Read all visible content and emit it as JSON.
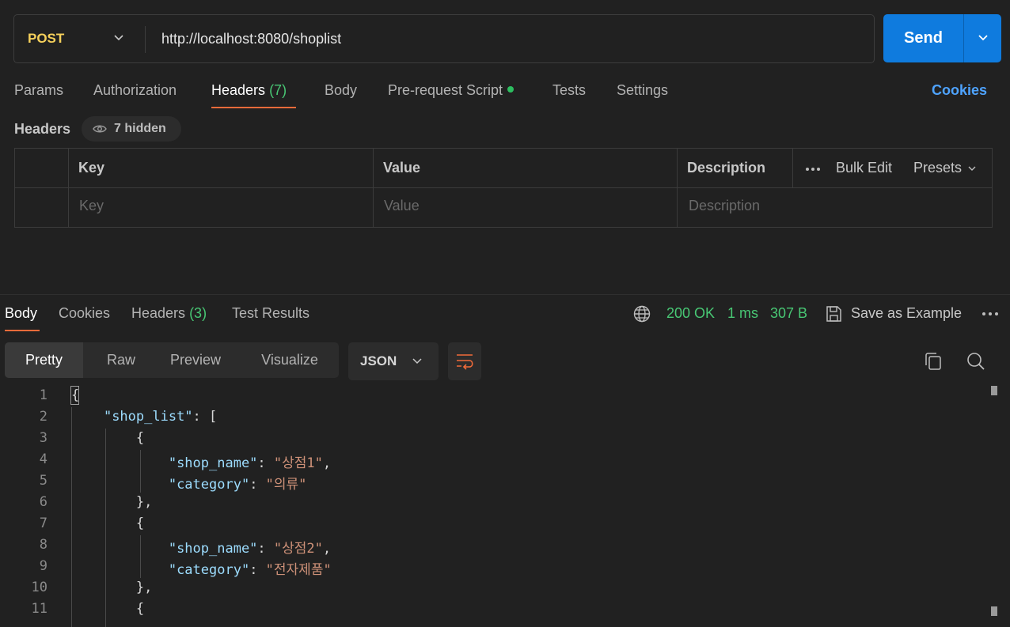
{
  "request": {
    "method": "POST",
    "url": "http://localhost:8080/shoplist",
    "send_label": "Send"
  },
  "request_tabs": {
    "params": "Params",
    "authorization": "Authorization",
    "headers": "Headers",
    "headers_count": "(7)",
    "body": "Body",
    "prerequest": "Pre-request Script",
    "tests": "Tests",
    "settings": "Settings",
    "cookies": "Cookies"
  },
  "headers_section": {
    "label": "Headers",
    "hidden": "7 hidden",
    "columns": {
      "key": "Key",
      "value": "Value",
      "description": "Description"
    },
    "placeholders": {
      "key": "Key",
      "value": "Value",
      "description": "Description"
    },
    "bulk_edit": "Bulk Edit",
    "presets": "Presets"
  },
  "response_tabs": {
    "body": "Body",
    "cookies": "Cookies",
    "headers": "Headers",
    "headers_count": "(3)",
    "test_results": "Test Results"
  },
  "response_status": {
    "status": "200 OK",
    "time": "1 ms",
    "size": "307 B",
    "save_as_example": "Save as Example"
  },
  "view_modes": {
    "pretty": "Pretty",
    "raw": "Raw",
    "preview": "Preview",
    "visualize": "Visualize",
    "format": "JSON"
  },
  "code_lines": {
    "n1": "1",
    "n2": "2",
    "n3": "3",
    "n4": "4",
    "n5": "5",
    "n6": "6",
    "n7": "7",
    "n8": "8",
    "n9": "9",
    "n10": "10",
    "n11": "11",
    "l2_key": "\"shop_list\"",
    "l4_key": "\"shop_name\"",
    "l4_val": "\"상점1\"",
    "l5_key": "\"category\"",
    "l5_val": "\"의류\"",
    "l8_key": "\"shop_name\"",
    "l8_val": "\"상점2\"",
    "l9_key": "\"category\"",
    "l9_val": "\"전자제품\""
  },
  "colors": {
    "accent": "#f26b3a",
    "send": "#0f7bde",
    "method": "#f5d05b",
    "success": "#48c774",
    "link": "#4ea3ff"
  }
}
